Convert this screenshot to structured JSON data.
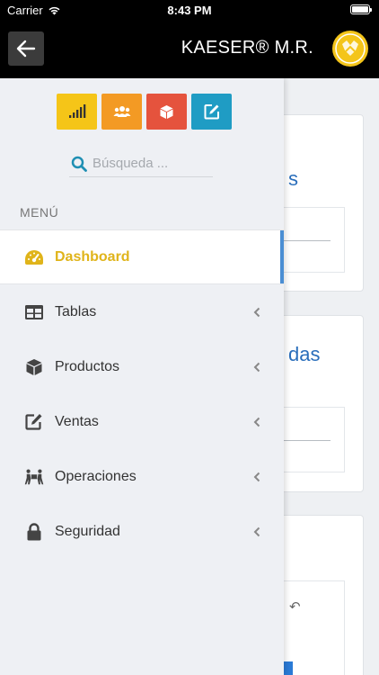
{
  "status_bar": {
    "carrier": "Carrier",
    "time": "8:43 PM",
    "wifi_icon": "wifi-icon",
    "battery_level": 1.0
  },
  "header": {
    "back_icon": "arrow-left-icon",
    "title": "KAESER® M.R.",
    "logo_icon": "kaeser-logo"
  },
  "drawer": {
    "quick_buttons": [
      {
        "icon": "signal-bars-icon",
        "color": "#f5c518"
      },
      {
        "icon": "users-icon",
        "color": "#f39a24"
      },
      {
        "icon": "box-icon",
        "color": "#e5533d"
      },
      {
        "icon": "edit-icon",
        "color": "#1f9cc4"
      }
    ],
    "search": {
      "placeholder": "Búsqueda ...",
      "value": "",
      "icon": "search-icon"
    },
    "menu_heading": "MENÚ",
    "menu_items": [
      {
        "label": "Dashboard",
        "icon": "dashboard-icon",
        "active": true,
        "has_submenu": false
      },
      {
        "label": "Tablas",
        "icon": "table-icon",
        "active": false,
        "has_submenu": true
      },
      {
        "label": "Productos",
        "icon": "cube-icon",
        "active": false,
        "has_submenu": true
      },
      {
        "label": "Ventas",
        "icon": "edit-icon",
        "active": false,
        "has_submenu": true
      },
      {
        "label": "Operaciones",
        "icon": "people-carry-icon",
        "active": false,
        "has_submenu": true
      },
      {
        "label": "Seguridad",
        "icon": "lock-icon",
        "active": false,
        "has_submenu": true
      }
    ]
  },
  "background": {
    "card1_text": "s",
    "card2_text": "das",
    "undo_icon": "undo-icon"
  },
  "colors": {
    "accent": "#e0b41a",
    "active_indicator": "#4a8ed3",
    "header_bg": "#000000",
    "link_blue": "#2a6ebb"
  }
}
